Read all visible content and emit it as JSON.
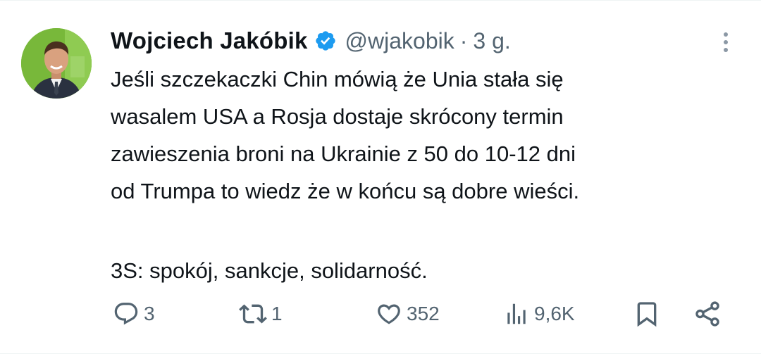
{
  "tweet": {
    "author": {
      "display_name": "Wojciech Jakóbik",
      "handle": "@wjakobik",
      "verified": true,
      "avatar": "profile-photo"
    },
    "separator": "·",
    "timestamp": "3 g.",
    "text_lines": [
      "Jeśli szczekaczki Chin mówią że Unia stała się",
      "wasalem USA a Rosja dostaje skrócony termin",
      "zawieszenia broni na Ukrainie z 50 do 10-12 dni",
      "od Trumpa to wiedz że w końcu są dobre wieści.",
      "3S: spokój, sankcje, solidarność."
    ]
  },
  "actions": {
    "reply": {
      "icon": "reply-icon",
      "count": "3"
    },
    "retweet": {
      "icon": "retweet-icon",
      "count": "1"
    },
    "like": {
      "icon": "heart-icon",
      "count": "352"
    },
    "views": {
      "icon": "views-icon",
      "count": "9,6K"
    },
    "bookmark": {
      "icon": "bookmark-icon"
    },
    "share": {
      "icon": "share-icon"
    }
  },
  "colors": {
    "text": "#0f1419",
    "secondary": "#536471",
    "verified": "#1d9bf0",
    "icon": "#536471"
  }
}
